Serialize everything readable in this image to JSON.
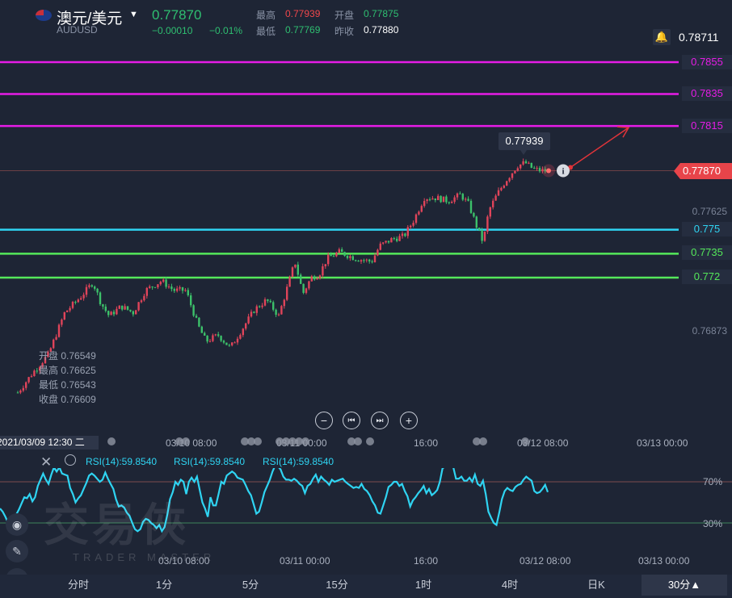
{
  "header": {
    "pair_name": "澳元/美元",
    "symbol": "AUDUSD",
    "price": "0.77870",
    "change": "−0.00010",
    "change_pct": "−0.01%",
    "high_label": "最高",
    "high": "0.77939",
    "open_label": "开盘",
    "open": "0.77875",
    "low_label": "最低",
    "low": "0.77769",
    "prev_close_label": "昨收",
    "prev_close": "0.77880"
  },
  "price_axis": {
    "top_value": "0.78711",
    "labels": [
      "0.77625",
      "0.76873"
    ]
  },
  "lines": [
    {
      "label": "0.7855",
      "color": "#e61ce6"
    },
    {
      "label": "0.7835",
      "color": "#e61ce6"
    },
    {
      "label": "0.7815",
      "color": "#e61ce6"
    },
    {
      "label": "0.775",
      "color": "#2fd4f2"
    },
    {
      "label": "0.7735",
      "color": "#54e85a"
    },
    {
      "label": "0.772",
      "color": "#54e85a"
    }
  ],
  "current_price_tag": "0.77870",
  "popup_high": "0.77939",
  "ohlc_overlay": {
    "open_label": "开盘",
    "open": "0.76549",
    "high_label": "最高",
    "high": "0.76625",
    "low_label": "最低",
    "low": "0.76543",
    "close_label": "收盘",
    "close": "0.76609"
  },
  "time_axis": {
    "cursor_time": "2021/03/09 12:30 二",
    "labels": [
      "03/10 08:00",
      "03/11 00:00",
      "16:00",
      "03/12 08:00",
      "03/13 00:00"
    ]
  },
  "rsi": {
    "labels": [
      "RSI(14):59.8540",
      "RSI(14):59.8540",
      "RSI(14):59.8540"
    ],
    "level_high": "70%",
    "level_low": "30%",
    "values": [
      44,
      41,
      36,
      30,
      34,
      30,
      38,
      43,
      49,
      55,
      54,
      58,
      51,
      55,
      66,
      72,
      78,
      72,
      68,
      77,
      84,
      80,
      84,
      78,
      77,
      76,
      64,
      58,
      50,
      54,
      57,
      63,
      69,
      76,
      78,
      76,
      73,
      70,
      72,
      79,
      73,
      68,
      63,
      53,
      46,
      47,
      45,
      40,
      37,
      30,
      24,
      22,
      24,
      31,
      34,
      33,
      30,
      28,
      25,
      28,
      22,
      26,
      38,
      53,
      60,
      70,
      67,
      72,
      70,
      58,
      70,
      74,
      70,
      75,
      62,
      50,
      44,
      36,
      55,
      47,
      47,
      58,
      70,
      68,
      76,
      78,
      80,
      78,
      74,
      73,
      72,
      67,
      61,
      57,
      48,
      39,
      41,
      50,
      60,
      66,
      72,
      80,
      86,
      85,
      82,
      75,
      72,
      72,
      71,
      73,
      71,
      68,
      66,
      59,
      66,
      68,
      73,
      77,
      70,
      75,
      72,
      70,
      67,
      72,
      70,
      71,
      72,
      73,
      70,
      68,
      66,
      64,
      65,
      64,
      68,
      63,
      61,
      57,
      51,
      47,
      40,
      39,
      47,
      55,
      65,
      67,
      70,
      70,
      66,
      68,
      61,
      56,
      46,
      52,
      55,
      59,
      62,
      66,
      59,
      63,
      57,
      59,
      62,
      70,
      83,
      85,
      87,
      87,
      84,
      73,
      73,
      75,
      71,
      71,
      74,
      70,
      77,
      68,
      66,
      71,
      58,
      41,
      35,
      30,
      28,
      40,
      53,
      61,
      64,
      62,
      61,
      65,
      67,
      68,
      72,
      75,
      73,
      71,
      61,
      59,
      60,
      63,
      67,
      60
    ]
  },
  "controls": {
    "zoom_out": "−",
    "prev": "⏮",
    "next": "⏭",
    "zoom_in": "+"
  },
  "tabs": [
    "分时",
    "1分",
    "5分",
    "15分",
    "1时",
    "4时",
    "日K",
    "30分▲"
  ],
  "watermark": {
    "text": "交易俠",
    "sub": "TRADER MASTER"
  }
}
